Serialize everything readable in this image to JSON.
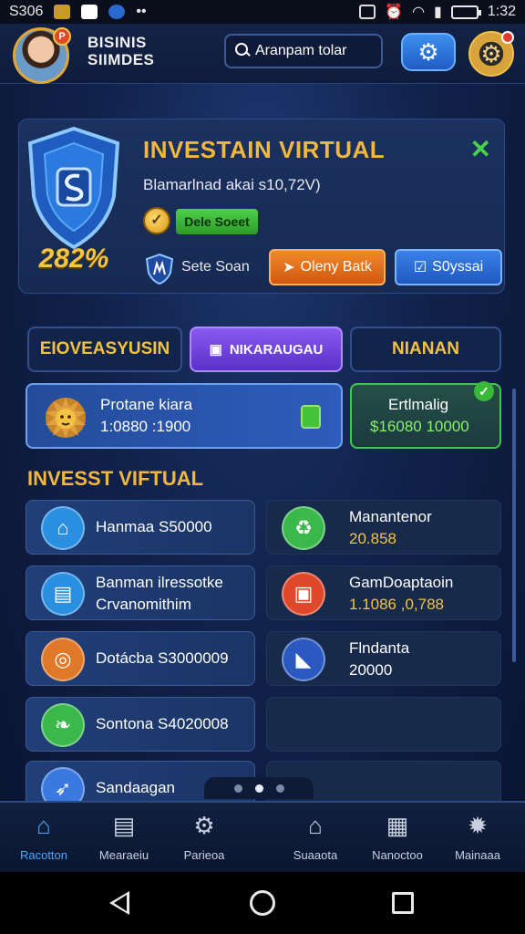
{
  "statusbar": {
    "left_text": "S306",
    "time": "1:32"
  },
  "header": {
    "brand_line1": "BISINIS",
    "brand_line2": "SIIMDES",
    "avatar_badge": "P",
    "search_placeholder": "Aranpam tolar"
  },
  "hero": {
    "percent": "282%",
    "title": "INVESTAIN VIRTUAL",
    "subtitle": "Blamarlnad akai s10,72V)",
    "badge": "Dele Soeet",
    "link": "Sete Soan",
    "btn_orange": "Oleny Batk",
    "btn_blue": "S0yssai"
  },
  "tabs": [
    {
      "label": "EIOVEASYUSIN"
    },
    {
      "label": "NIKARAUGAU"
    },
    {
      "label": "NIANAN"
    }
  ],
  "cards": {
    "left": {
      "title": "Protane kiara",
      "value": "1:0880 :1900"
    },
    "right": {
      "title": "Ertlmalig",
      "value": "$16080 10000"
    }
  },
  "section_title": "INVESST VIFTUAL",
  "items_left": [
    {
      "label": "Hanmaa S50000",
      "icon": "house-icon",
      "color": "#2a8fe0"
    },
    {
      "label_a": "Banman ilressotke",
      "label_b": "Crvanomithim",
      "icon": "toolbox-icon",
      "color": "#2a8fe0"
    },
    {
      "label": "Dotácba S3000009",
      "icon": "target-icon",
      "color": "#e0782a"
    },
    {
      "label": "Sontona S4020008",
      "icon": "leaf-icon",
      "color": "#3ab84a"
    },
    {
      "label": "Sandaagan",
      "icon": "rocket-icon",
      "color": "#3a7ae0"
    }
  ],
  "items_right": [
    {
      "label_a": "Manantenor",
      "label_b": "20.858",
      "icon": "recycle-icon",
      "color": "#3ab84a",
      "value_color": "#f2c242"
    },
    {
      "label_a": "GamDoaptaoin",
      "label_b": "1.1086 ,0,788",
      "icon": "frame-icon",
      "color": "#e0482a",
      "value_color": "#f2c242"
    },
    {
      "label_a": "Flndanta",
      "label_b": "20000",
      "icon": "chart-icon",
      "color": "#2a5ac0",
      "value_color": "#ffffff"
    }
  ],
  "bottom_nav": [
    {
      "label": "Racotton",
      "icon": "home-icon",
      "active": true
    },
    {
      "label": "Mearaeiu",
      "icon": "document-icon",
      "active": false
    },
    {
      "label": "Parieoa",
      "icon": "settings-icon",
      "active": false
    },
    {
      "label": "Suaaota",
      "icon": "building-icon",
      "active": false
    },
    {
      "label": "Nanoctoo",
      "icon": "store-icon",
      "active": false
    },
    {
      "label": "Mainaaa",
      "icon": "gear-icon",
      "active": false
    }
  ]
}
